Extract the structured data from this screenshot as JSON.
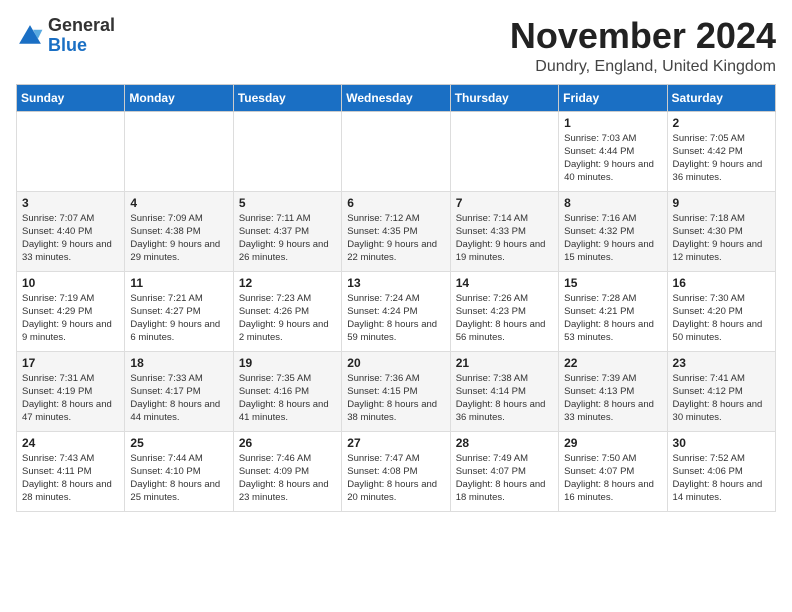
{
  "logo": {
    "general": "General",
    "blue": "Blue"
  },
  "title": "November 2024",
  "location": "Dundry, England, United Kingdom",
  "days_header": [
    "Sunday",
    "Monday",
    "Tuesday",
    "Wednesday",
    "Thursday",
    "Friday",
    "Saturday"
  ],
  "weeks": [
    [
      {
        "num": "",
        "info": ""
      },
      {
        "num": "",
        "info": ""
      },
      {
        "num": "",
        "info": ""
      },
      {
        "num": "",
        "info": ""
      },
      {
        "num": "",
        "info": ""
      },
      {
        "num": "1",
        "info": "Sunrise: 7:03 AM\nSunset: 4:44 PM\nDaylight: 9 hours and 40 minutes."
      },
      {
        "num": "2",
        "info": "Sunrise: 7:05 AM\nSunset: 4:42 PM\nDaylight: 9 hours and 36 minutes."
      }
    ],
    [
      {
        "num": "3",
        "info": "Sunrise: 7:07 AM\nSunset: 4:40 PM\nDaylight: 9 hours and 33 minutes."
      },
      {
        "num": "4",
        "info": "Sunrise: 7:09 AM\nSunset: 4:38 PM\nDaylight: 9 hours and 29 minutes."
      },
      {
        "num": "5",
        "info": "Sunrise: 7:11 AM\nSunset: 4:37 PM\nDaylight: 9 hours and 26 minutes."
      },
      {
        "num": "6",
        "info": "Sunrise: 7:12 AM\nSunset: 4:35 PM\nDaylight: 9 hours and 22 minutes."
      },
      {
        "num": "7",
        "info": "Sunrise: 7:14 AM\nSunset: 4:33 PM\nDaylight: 9 hours and 19 minutes."
      },
      {
        "num": "8",
        "info": "Sunrise: 7:16 AM\nSunset: 4:32 PM\nDaylight: 9 hours and 15 minutes."
      },
      {
        "num": "9",
        "info": "Sunrise: 7:18 AM\nSunset: 4:30 PM\nDaylight: 9 hours and 12 minutes."
      }
    ],
    [
      {
        "num": "10",
        "info": "Sunrise: 7:19 AM\nSunset: 4:29 PM\nDaylight: 9 hours and 9 minutes."
      },
      {
        "num": "11",
        "info": "Sunrise: 7:21 AM\nSunset: 4:27 PM\nDaylight: 9 hours and 6 minutes."
      },
      {
        "num": "12",
        "info": "Sunrise: 7:23 AM\nSunset: 4:26 PM\nDaylight: 9 hours and 2 minutes."
      },
      {
        "num": "13",
        "info": "Sunrise: 7:24 AM\nSunset: 4:24 PM\nDaylight: 8 hours and 59 minutes."
      },
      {
        "num": "14",
        "info": "Sunrise: 7:26 AM\nSunset: 4:23 PM\nDaylight: 8 hours and 56 minutes."
      },
      {
        "num": "15",
        "info": "Sunrise: 7:28 AM\nSunset: 4:21 PM\nDaylight: 8 hours and 53 minutes."
      },
      {
        "num": "16",
        "info": "Sunrise: 7:30 AM\nSunset: 4:20 PM\nDaylight: 8 hours and 50 minutes."
      }
    ],
    [
      {
        "num": "17",
        "info": "Sunrise: 7:31 AM\nSunset: 4:19 PM\nDaylight: 8 hours and 47 minutes."
      },
      {
        "num": "18",
        "info": "Sunrise: 7:33 AM\nSunset: 4:17 PM\nDaylight: 8 hours and 44 minutes."
      },
      {
        "num": "19",
        "info": "Sunrise: 7:35 AM\nSunset: 4:16 PM\nDaylight: 8 hours and 41 minutes."
      },
      {
        "num": "20",
        "info": "Sunrise: 7:36 AM\nSunset: 4:15 PM\nDaylight: 8 hours and 38 minutes."
      },
      {
        "num": "21",
        "info": "Sunrise: 7:38 AM\nSunset: 4:14 PM\nDaylight: 8 hours and 36 minutes."
      },
      {
        "num": "22",
        "info": "Sunrise: 7:39 AM\nSunset: 4:13 PM\nDaylight: 8 hours and 33 minutes."
      },
      {
        "num": "23",
        "info": "Sunrise: 7:41 AM\nSunset: 4:12 PM\nDaylight: 8 hours and 30 minutes."
      }
    ],
    [
      {
        "num": "24",
        "info": "Sunrise: 7:43 AM\nSunset: 4:11 PM\nDaylight: 8 hours and 28 minutes."
      },
      {
        "num": "25",
        "info": "Sunrise: 7:44 AM\nSunset: 4:10 PM\nDaylight: 8 hours and 25 minutes."
      },
      {
        "num": "26",
        "info": "Sunrise: 7:46 AM\nSunset: 4:09 PM\nDaylight: 8 hours and 23 minutes."
      },
      {
        "num": "27",
        "info": "Sunrise: 7:47 AM\nSunset: 4:08 PM\nDaylight: 8 hours and 20 minutes."
      },
      {
        "num": "28",
        "info": "Sunrise: 7:49 AM\nSunset: 4:07 PM\nDaylight: 8 hours and 18 minutes."
      },
      {
        "num": "29",
        "info": "Sunrise: 7:50 AM\nSunset: 4:07 PM\nDaylight: 8 hours and 16 minutes."
      },
      {
        "num": "30",
        "info": "Sunrise: 7:52 AM\nSunset: 4:06 PM\nDaylight: 8 hours and 14 minutes."
      }
    ]
  ]
}
